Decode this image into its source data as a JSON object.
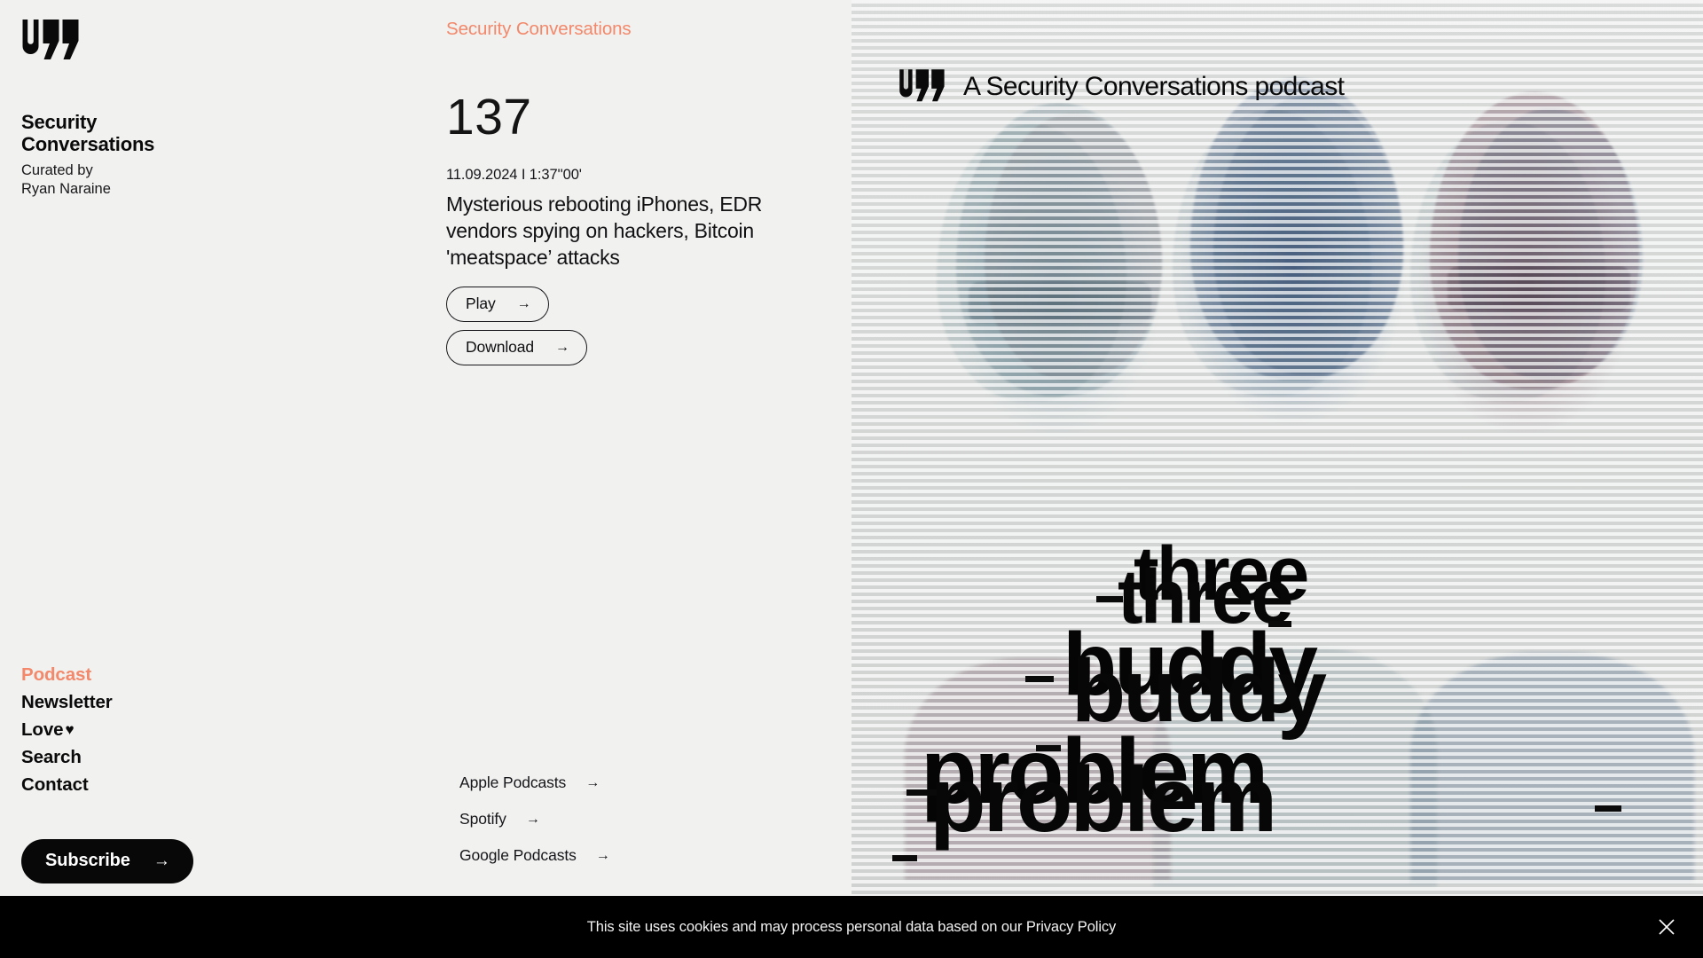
{
  "brand": {
    "logo_icon": "quote-mark-logo-icon",
    "title": "Security Conversations",
    "curated_label": "Curated by",
    "curator": "Ryan Naraine"
  },
  "nav": {
    "items": [
      {
        "label": "Podcast",
        "active": true
      },
      {
        "label": "Newsletter",
        "active": false
      },
      {
        "label": "Love",
        "active": false,
        "suffix_icon": "heart-icon",
        "suffix_glyph": "♥"
      },
      {
        "label": "Search",
        "active": false
      },
      {
        "label": "Contact",
        "active": false
      }
    ],
    "subscribe": {
      "label": "Subscribe",
      "arrow_icon": "arrow-right-icon",
      "arrow_glyph": "→"
    }
  },
  "main": {
    "eyebrow": "Security Conversations",
    "episode_number": "137",
    "episode_meta": "11.09.2024 I 1:37''00'",
    "episode_title": "Mysterious rebooting iPhones, EDR vendors spying on hackers, Bitcoin 'meatspace’ attacks",
    "buttons": [
      {
        "label": "Play",
        "arrow_icon": "arrow-right-icon",
        "arrow_glyph": "→"
      },
      {
        "label": "Download",
        "arrow_icon": "arrow-right-icon",
        "arrow_glyph": "→"
      }
    ],
    "platform_links": [
      {
        "label": "Apple Podcasts",
        "arrow_glyph": "→"
      },
      {
        "label": "Spotify",
        "arrow_glyph": "→"
      },
      {
        "label": "Google Podcasts",
        "arrow_glyph": "→"
      }
    ]
  },
  "artwork": {
    "header_logo_icon": "quote-mark-logo-icon",
    "header_text": "A Security Conversations podcast",
    "title_words": [
      "three",
      "buddy",
      "problem"
    ],
    "style": "scanline-duotone-glitch",
    "subjects": "three-podcast-hosts-portrait"
  },
  "cookie_banner": {
    "text_before": "This site uses cookies and may process personal data based on our ",
    "policy_link": "Privacy Policy",
    "close_icon": "close-icon"
  },
  "colors": {
    "accent_coral": "#F3886A",
    "page_background": "#F1F1F0",
    "text_primary": "#0A0A0A",
    "cookie_bar": "#000000",
    "subscribe_button": "#080808"
  }
}
